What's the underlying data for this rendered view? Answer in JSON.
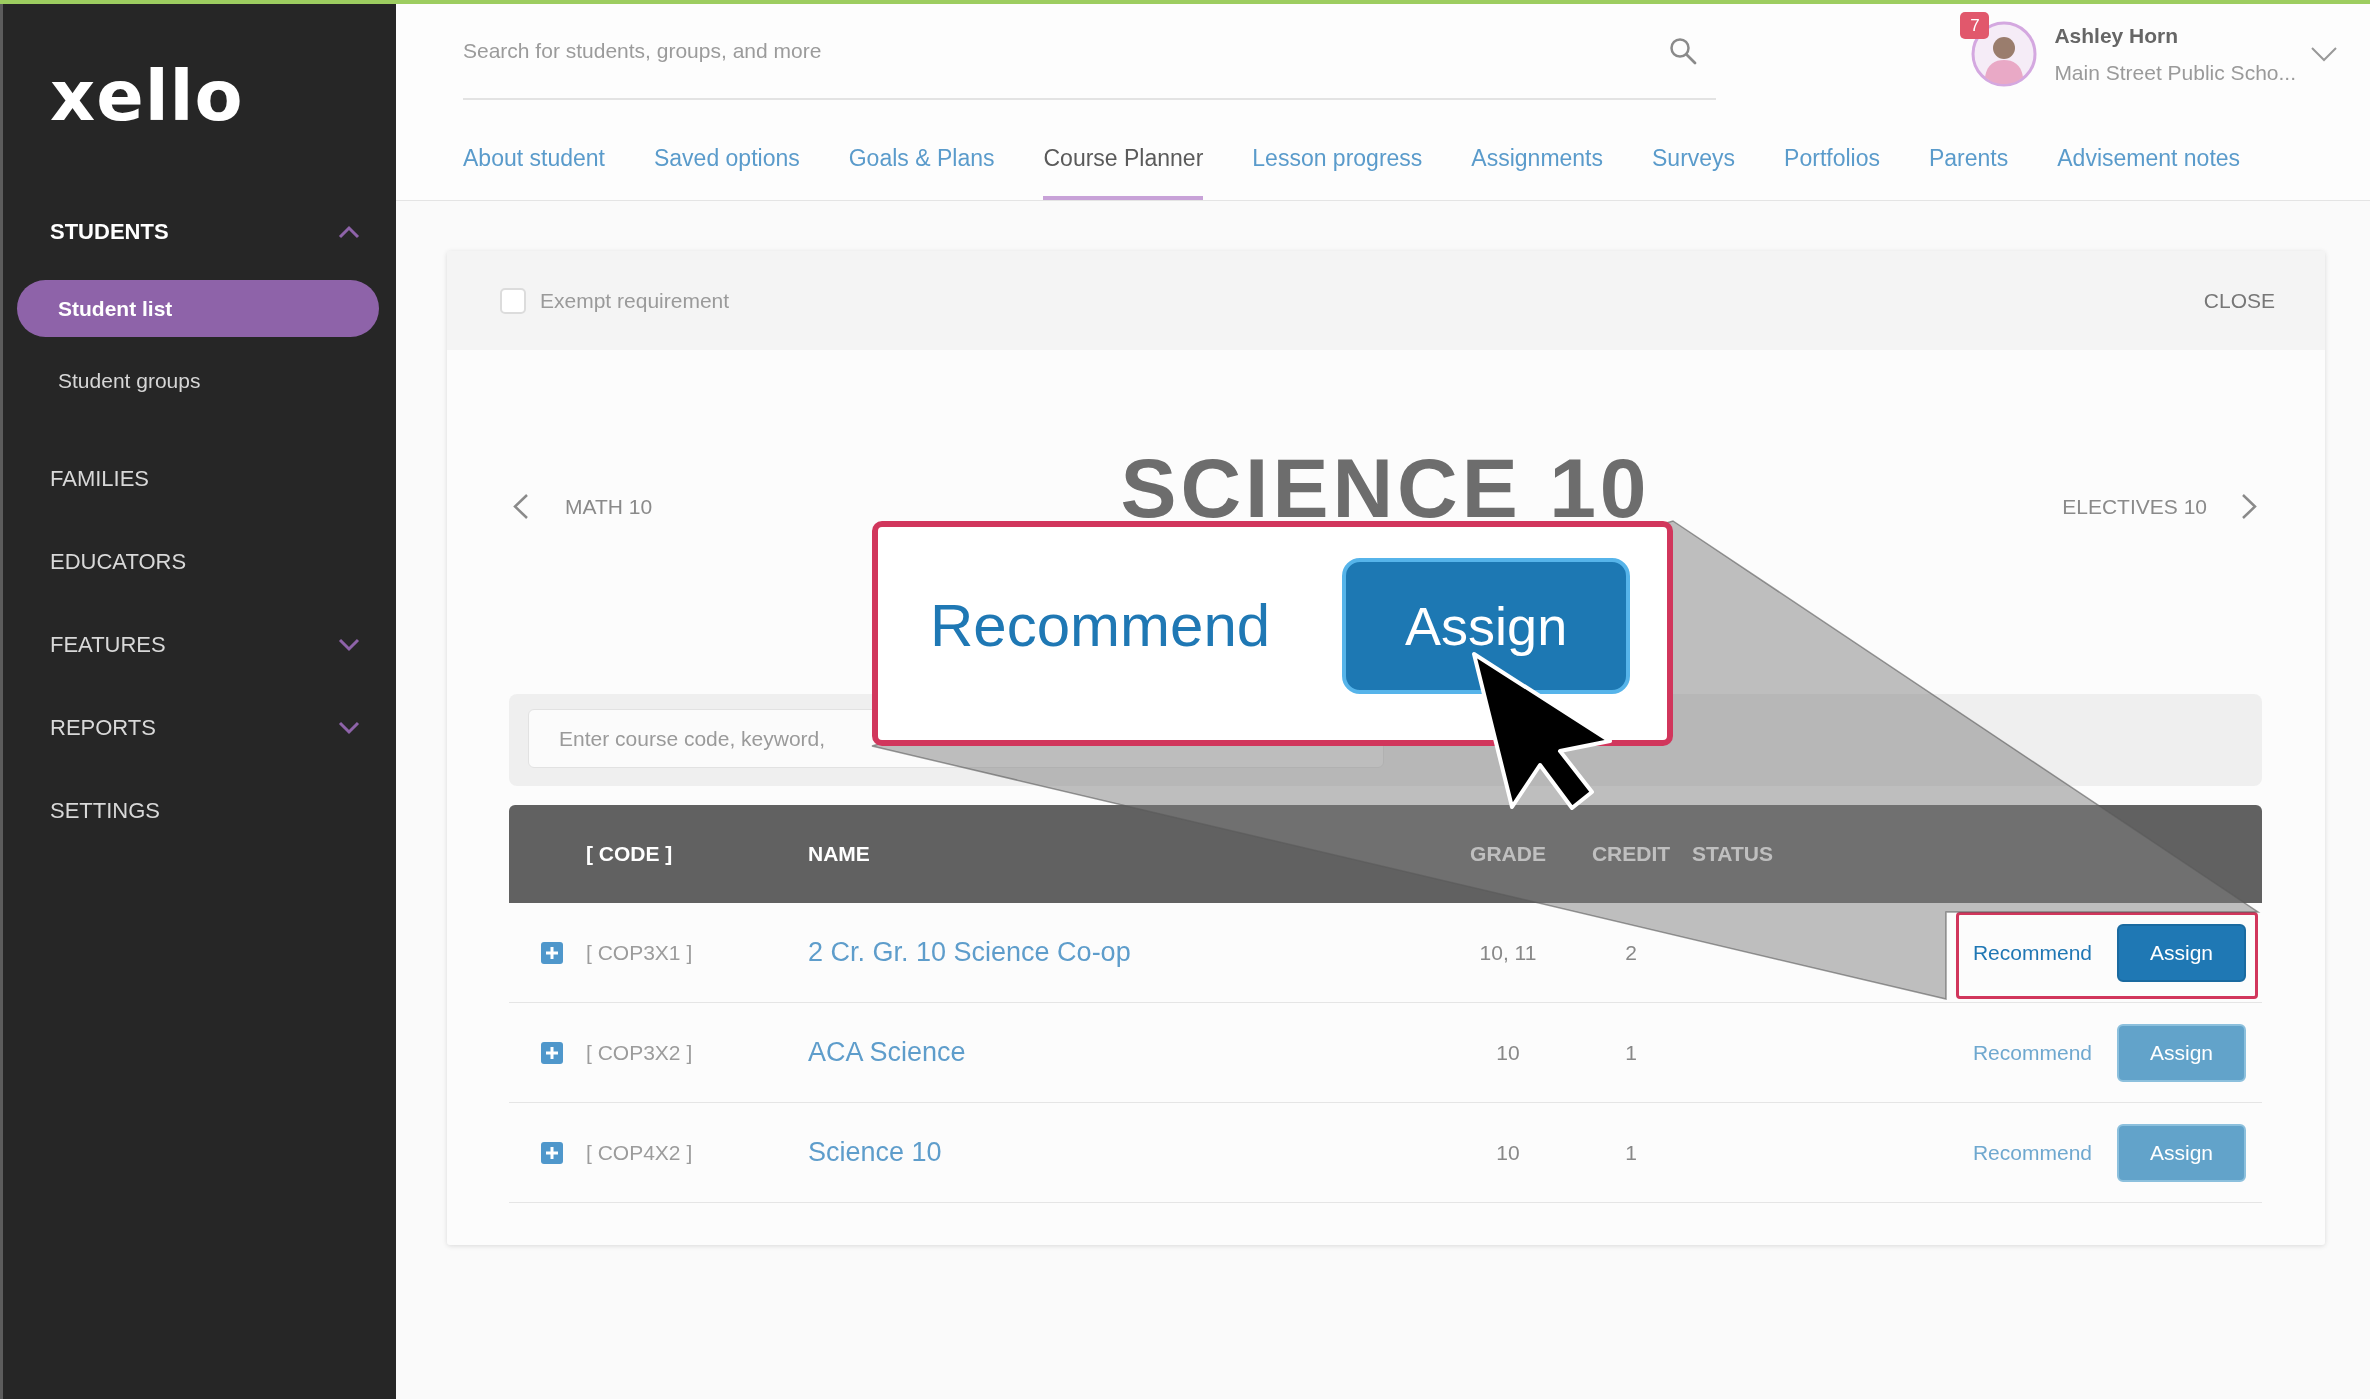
{
  "top_bar": {
    "search": {
      "placeholder": "Search for students, groups, and more"
    },
    "user": {
      "name": "Ashley Horn",
      "school": "Main Street Public Scho...",
      "notifications": "7"
    }
  },
  "sidebar": {
    "logo": "xello",
    "items": [
      {
        "label": "STUDENTS",
        "kind": "group",
        "expanded": true,
        "children": [
          {
            "label": "Student list",
            "selected": true
          },
          {
            "label": "Student groups",
            "selected": false
          }
        ]
      },
      {
        "label": "FAMILIES",
        "kind": "link"
      },
      {
        "label": "EDUCATORS",
        "kind": "link"
      },
      {
        "label": "FEATURES",
        "kind": "group",
        "expanded": false
      },
      {
        "label": "REPORTS",
        "kind": "group",
        "expanded": false
      },
      {
        "label": "SETTINGS",
        "kind": "link"
      }
    ]
  },
  "tabs": [
    {
      "label": "About student",
      "selected": false
    },
    {
      "label": "Saved options",
      "selected": false
    },
    {
      "label": "Goals & Plans",
      "selected": false
    },
    {
      "label": "Course Planner",
      "selected": true
    },
    {
      "label": "Lesson progress",
      "selected": false
    },
    {
      "label": "Assignments",
      "selected": false
    },
    {
      "label": "Surveys",
      "selected": false
    },
    {
      "label": "Portfolios",
      "selected": false
    },
    {
      "label": "Parents",
      "selected": false
    },
    {
      "label": "Advisement notes",
      "selected": false
    }
  ],
  "panel": {
    "exempt": {
      "label": "Exempt requirement",
      "checked": false
    },
    "close": "CLOSE",
    "previous": "MATH 10",
    "title": "SCIENCE 10",
    "next": "ELECTIVES 10",
    "search": {
      "placeholder": "Enter course code, keyword,"
    },
    "table": {
      "columns": [
        "[ CODE ]",
        "NAME",
        "GRADE",
        "CREDIT",
        "STATUS"
      ],
      "rows": [
        {
          "code": "[ COP3X1 ]",
          "name": "2 Cr. Gr. 10 Science Co-op",
          "grade": "10, 11",
          "credit": "2",
          "recommend": "Recommend",
          "assign": "Assign",
          "highlighted": true
        },
        {
          "code": "[ COP3X2 ]",
          "name": "ACA Science",
          "grade": "10",
          "credit": "1",
          "recommend": "Recommend",
          "assign": "Assign",
          "highlighted": false
        },
        {
          "code": "[ COP4X2 ]",
          "name": "Science 10",
          "grade": "10",
          "credit": "1",
          "recommend": "Recommend",
          "assign": "Assign",
          "highlighted": false
        }
      ]
    }
  },
  "callout": {
    "recommend": "Recommend",
    "assign": "Assign"
  }
}
